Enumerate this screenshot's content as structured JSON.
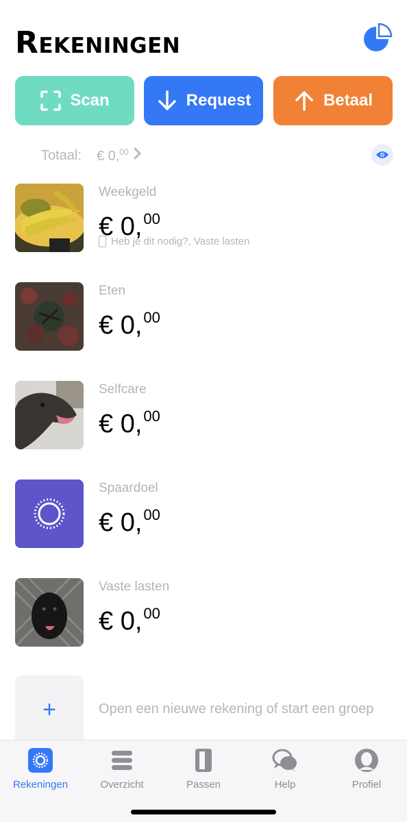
{
  "header": {
    "title": "Rekeningen",
    "chart_button_icon": "pie-chart-icon"
  },
  "actions": {
    "scan": {
      "label": "Scan",
      "icon": "scan-frame-icon",
      "color": "#6fdcc2"
    },
    "request": {
      "label": "Request",
      "icon": "arrow-down-icon",
      "color": "#3478f6"
    },
    "pay": {
      "label": "Betaal",
      "icon": "arrow-up-icon",
      "color": "#f08135"
    }
  },
  "total": {
    "label": "Totaal:",
    "amount_main": "€ 0,",
    "amount_cents": "00",
    "visibility_icon": "eye-icon"
  },
  "accounts": [
    {
      "name": "Weekgeld",
      "amount_main": "€ 0,",
      "amount_cents": "00",
      "subtitle": "Heb je dit nodig?, Vaste lasten",
      "image": "bananas-photo"
    },
    {
      "name": "Eten",
      "amount_main": "€ 0,",
      "amount_cents": "00",
      "image": "food-photo"
    },
    {
      "name": "Selfcare",
      "amount_main": "€ 0,",
      "amount_cents": "00",
      "image": "dog-photo"
    },
    {
      "name": "Spaardoel",
      "amount_main": "€ 0,",
      "amount_cents": "00",
      "image": "savings-goal-icon"
    },
    {
      "name": "Vaste lasten",
      "amount_main": "€ 0,",
      "amount_cents": "00",
      "image": "black-dog-photo"
    }
  ],
  "add_account": {
    "plus": "+",
    "label": "Open een nieuwe rekening of start een groep"
  },
  "tabbar": {
    "accent": "#3478f6",
    "tabs": [
      {
        "label": "Rekeningen",
        "icon": "accounts-icon",
        "active": true
      },
      {
        "label": "Overzicht",
        "icon": "list-icon",
        "active": false
      },
      {
        "label": "Passen",
        "icon": "card-icon",
        "active": false
      },
      {
        "label": "Help",
        "icon": "chat-bubbles-icon",
        "active": false
      },
      {
        "label": "Profiel",
        "icon": "person-icon",
        "active": false
      }
    ]
  }
}
